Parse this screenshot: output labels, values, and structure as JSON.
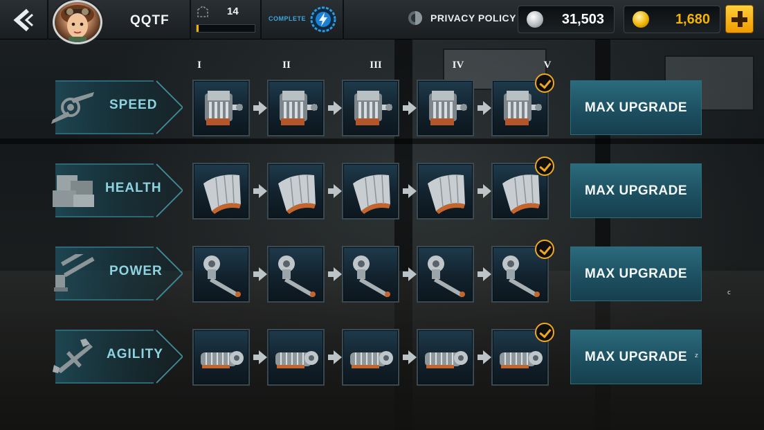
{
  "header": {
    "player_name": "QQTF",
    "level": "14",
    "level_progress": 0.03,
    "complete_label": "COMPLETE",
    "privacy_label": "PRIVACY POLICY",
    "silver_amount": "31,503",
    "gold_amount": "1,680"
  },
  "tiers": [
    "I",
    "II",
    "III",
    "IV",
    "V"
  ],
  "rows": [
    {
      "label": "SPEED",
      "icon": "propeller-icon",
      "part_icon": "engine-icon",
      "button": "MAX UPGRADE",
      "completed_tier": "V"
    },
    {
      "label": "HEALTH",
      "icon": "armor-plates-icon",
      "part_icon": "armor-panel-icon",
      "button": "MAX UPGRADE",
      "completed_tier": "V"
    },
    {
      "label": "POWER",
      "icon": "machine-guns-icon",
      "part_icon": "cannon-icon",
      "button": "MAX UPGRADE",
      "completed_tier": "V"
    },
    {
      "label": "AGILITY",
      "icon": "plane-icon",
      "part_icon": "turbine-icon",
      "button": "MAX UPGRADE",
      "completed_tier": "V"
    }
  ],
  "stray_text": [
    "c",
    "z"
  ],
  "colors": {
    "category_text": "#8fd3e0",
    "button_bg": "#1d5061",
    "check_accent": "#f0a822",
    "gold_text": "#f4b400",
    "complete_text": "#39a9df"
  }
}
